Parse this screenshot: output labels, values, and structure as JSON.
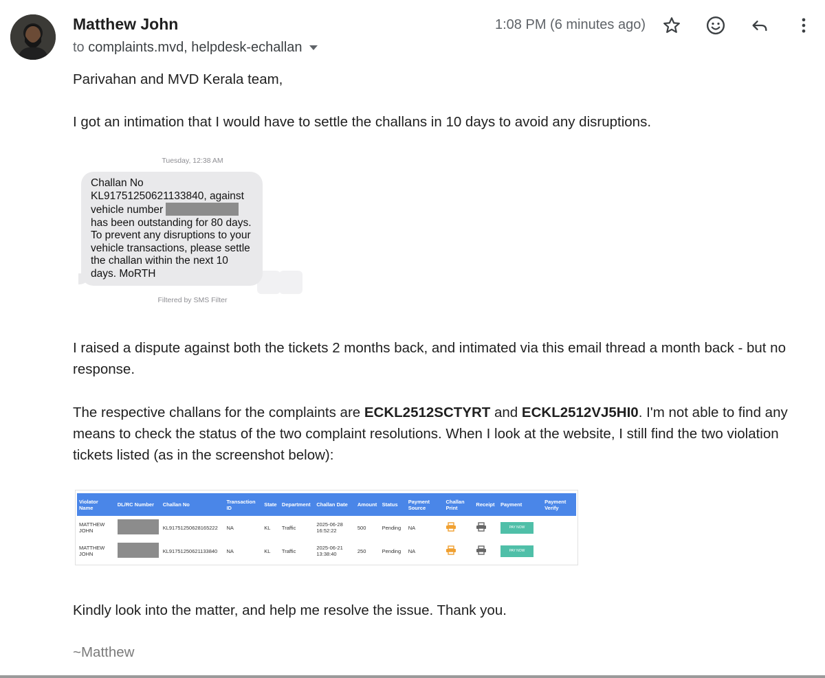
{
  "header": {
    "sender_name": "Matthew John",
    "to_prefix": "to",
    "recipients": "complaints.mvd, helpdesk-echallan",
    "time": "1:08 PM (6 minutes ago)"
  },
  "body": {
    "greeting": "Parivahan and MVD Kerala team,",
    "para1": "I got an intimation that I would have to settle the challans in 10 days to avoid any disruptions.",
    "para2": "I raised a dispute against both the tickets 2 months back, and intimated via this email thread a month back - but no response.",
    "para3_a": "The respective challans for the complaints are ",
    "challan_1": "ECKL2512SCTYRT",
    "para3_b": " and ",
    "challan_2": "ECKL2512VJ5HI0",
    "para3_c": ". I'm not able to find any means to check the status of the two complaint resolutions. When I look at the website, I still find the two violation tickets listed (as in the screenshot below):",
    "para4": "Kindly look into the matter, and help me resolve the issue. Thank you.",
    "signature": "~Matthew"
  },
  "sms": {
    "time": "Tuesday, 12:38 AM",
    "text_1": "Challan No KL91751250621133840, against vehicle number",
    "text_2": "has been outstanding for 80 days. To prevent any disruptions to your vehicle transactions, please settle the challan within the next 10 days. MoRTH",
    "filter_note": "Filtered by SMS Filter"
  },
  "challan_table": {
    "headers": [
      "Violator Name",
      "DL/RC Number",
      "Challan No",
      "Transaction ID",
      "State",
      "Department",
      "Challan Date",
      "Amount",
      "Status",
      "Payment Source",
      "Challan Print",
      "Receipt",
      "Payment",
      "Payment Verify"
    ],
    "rows": [
      {
        "name": "MATTHEW JOHN",
        "challan_no": "KL91751250628165222",
        "transaction_id": "NA",
        "state": "KL",
        "department": "Traffic",
        "date": "2025-06-28 16:52:22",
        "amount": "500",
        "status": "Pending",
        "payment_source": "NA",
        "pay_label": "PAY NOW"
      },
      {
        "name": "MATTHEW JOHN",
        "challan_no": "KL91751250621133840",
        "transaction_id": "NA",
        "state": "KL",
        "department": "Traffic",
        "date": "2025-06-21 13:38:40",
        "amount": "250",
        "status": "Pending",
        "payment_source": "NA",
        "pay_label": "PAY NOW"
      }
    ]
  },
  "icons": {
    "star": "star-icon",
    "emoji": "emoji-icon",
    "reply": "reply-icon",
    "more": "more-vert-icon",
    "dropdown": "chevron-down-icon",
    "print_challan": "printer-icon",
    "print_receipt": "printer-icon"
  },
  "colors": {
    "table_header": "#4a86e8",
    "pay_button": "#4fbfa8",
    "print_orange": "#f0a030"
  }
}
